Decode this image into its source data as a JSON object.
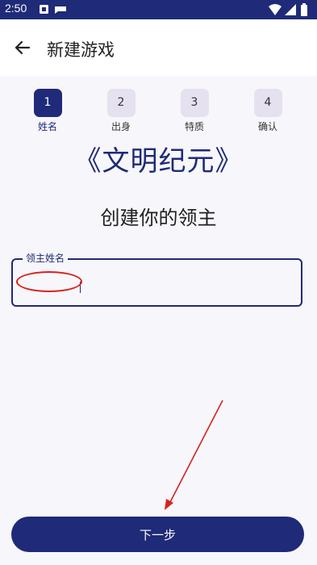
{
  "status_bar": {
    "time": "2:50",
    "icons_left": [
      "notification-icon",
      "message-icon"
    ],
    "icons_right": [
      "wifi-icon",
      "signal-icon",
      "battery-icon"
    ]
  },
  "app_bar": {
    "title": "新建游戏",
    "back_icon": "arrow-left-icon"
  },
  "stepper": {
    "active_step": 1,
    "steps": [
      {
        "number": "1",
        "label": "姓名"
      },
      {
        "number": "2",
        "label": "出身"
      },
      {
        "number": "3",
        "label": "特质"
      },
      {
        "number": "4",
        "label": "确认"
      }
    ]
  },
  "brand_title": "《文明纪元》",
  "heading": "创建你的领主",
  "name_field": {
    "label": "领主姓名",
    "value": ""
  },
  "next_button": {
    "label": "下一步"
  },
  "colors": {
    "primary": "#1f2a78",
    "step_inactive": "#e6e1ef",
    "background": "#f7f6fa",
    "annotation": "#d8221e"
  }
}
